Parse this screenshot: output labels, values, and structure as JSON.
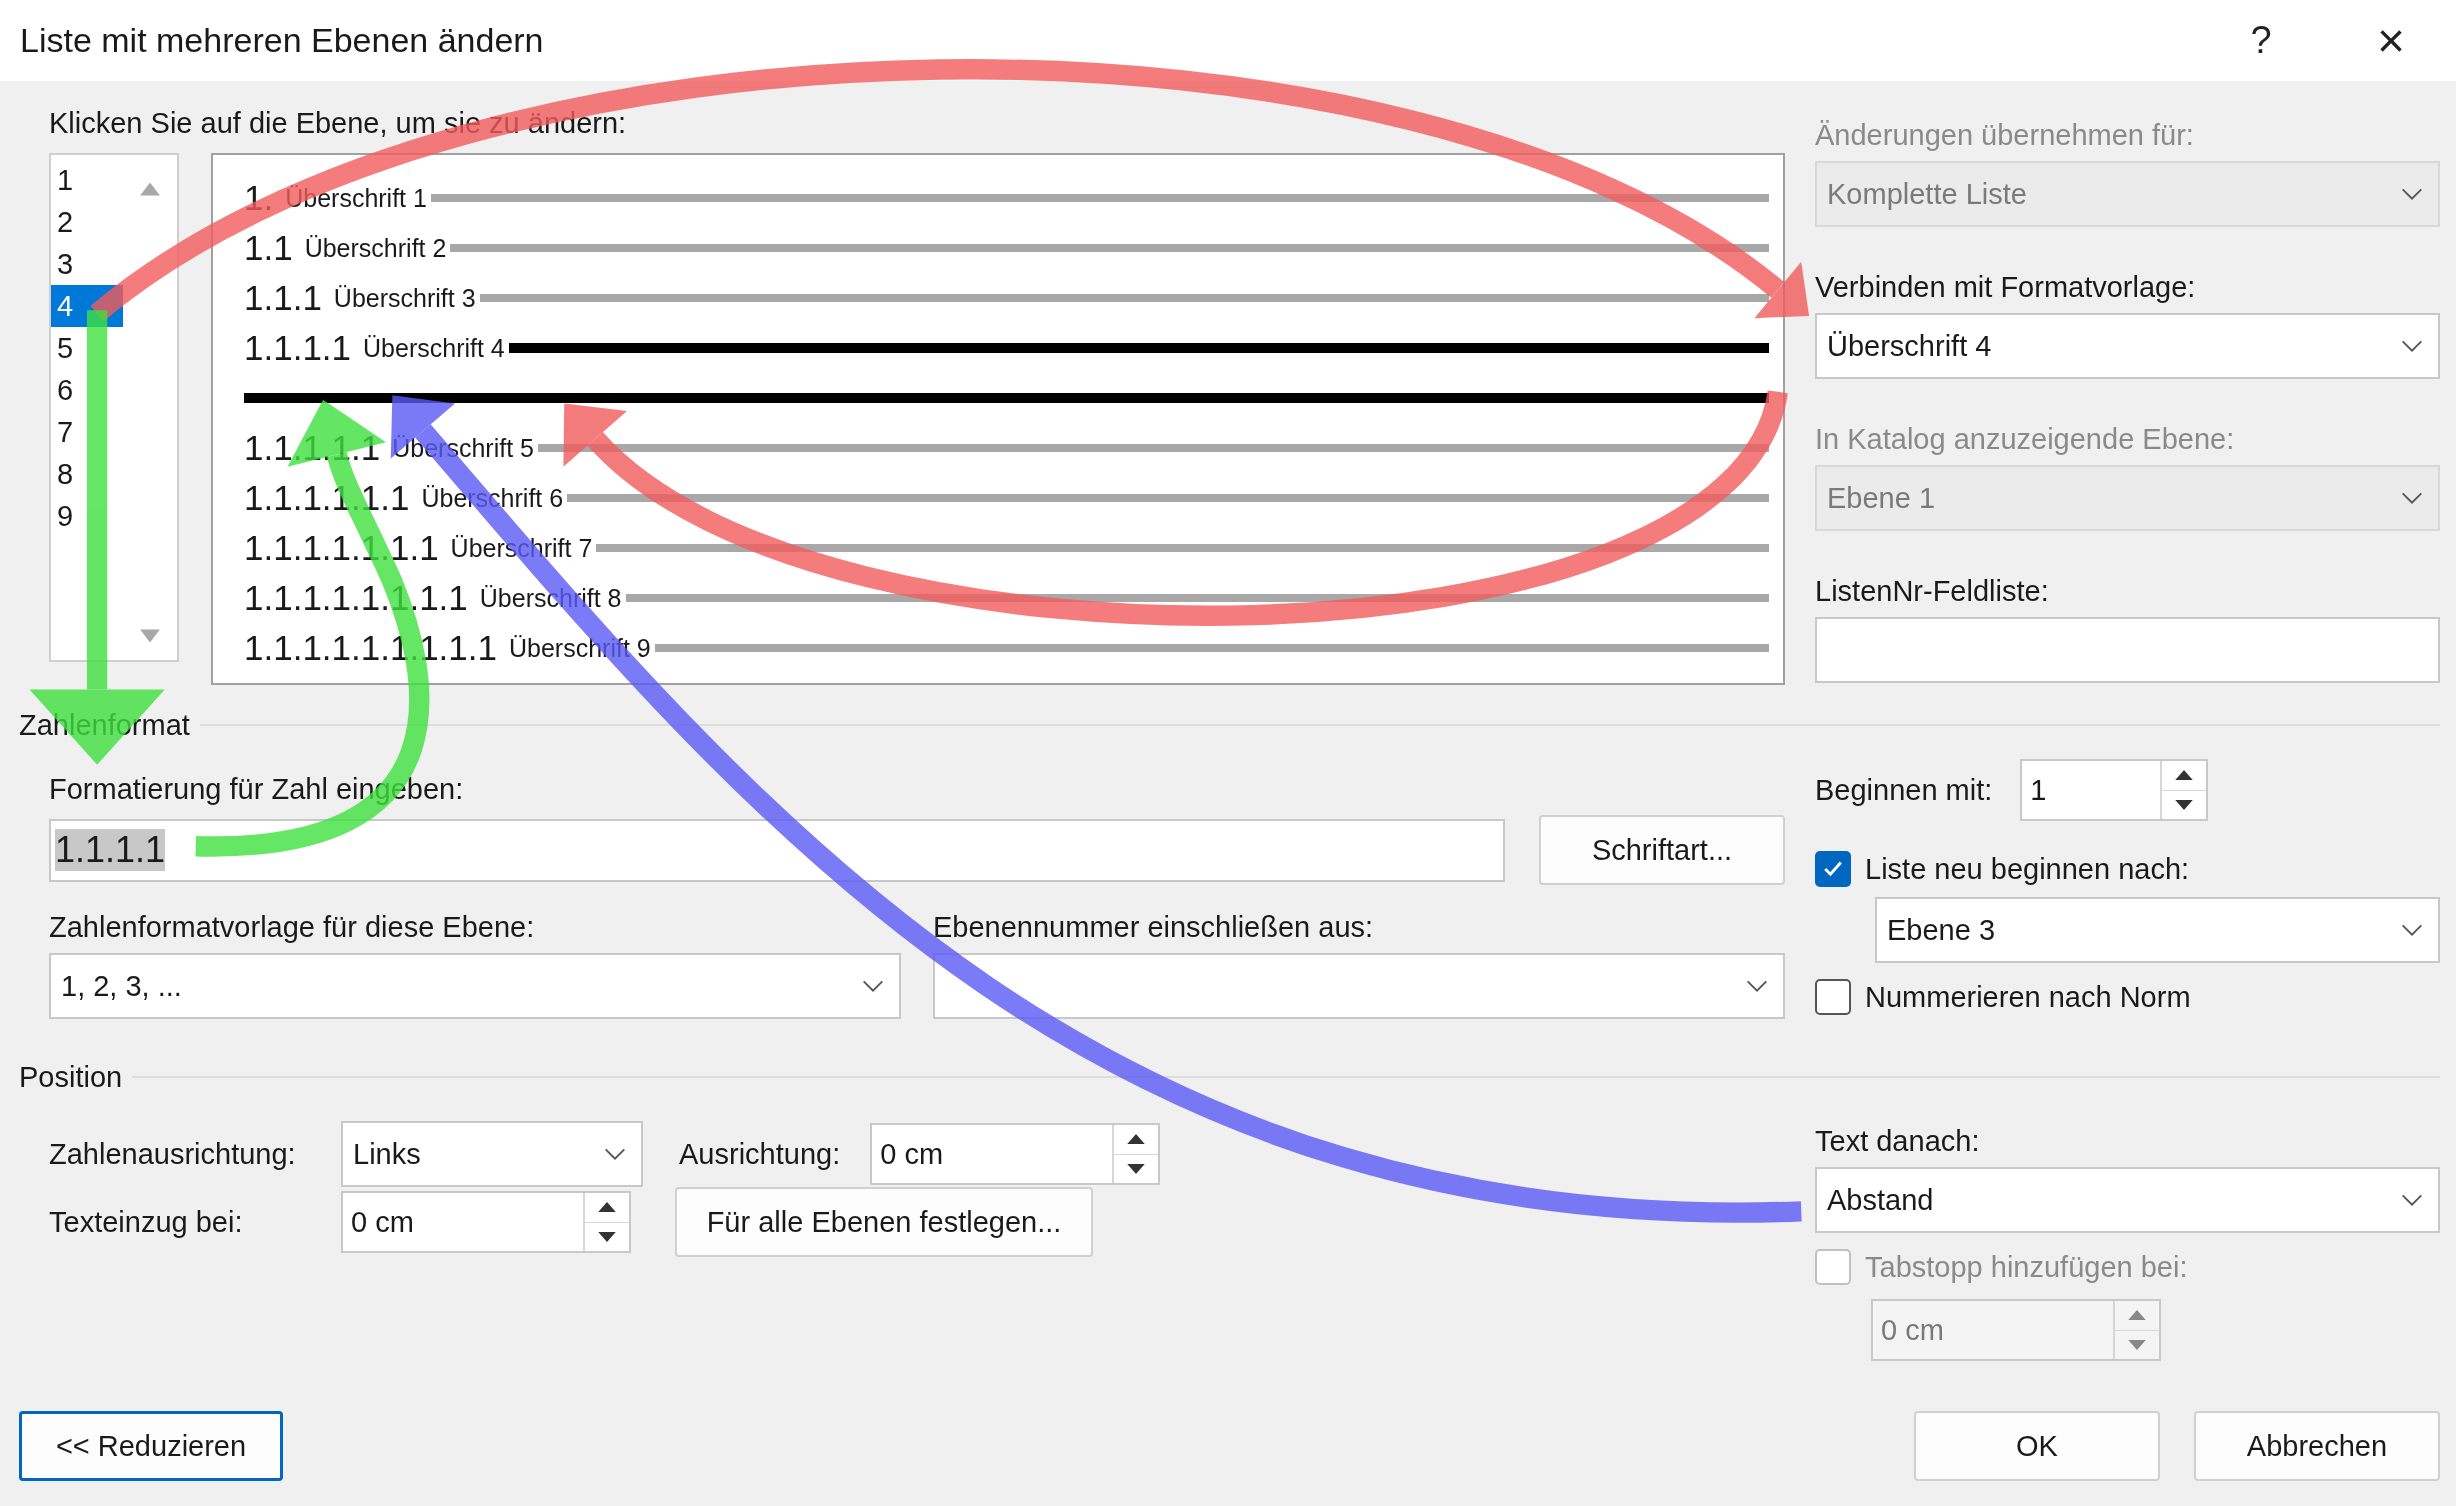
{
  "window": {
    "title": "Liste mit mehreren Ebenen ändern",
    "help": "?",
    "close": "×"
  },
  "level_picker": {
    "label": "Klicken Sie auf die Ebene, um sie zu ändern:",
    "levels": [
      {
        "label": "1",
        "selected": false
      },
      {
        "label": "2",
        "selected": false
      },
      {
        "label": "3",
        "selected": false
      },
      {
        "label": "4",
        "selected": true
      },
      {
        "label": "5",
        "selected": false
      },
      {
        "label": "6",
        "selected": false
      },
      {
        "label": "7",
        "selected": false
      },
      {
        "label": "8",
        "selected": false
      },
      {
        "label": "9",
        "selected": false
      }
    ]
  },
  "preview": [
    {
      "number": "1.",
      "label": "Überschrift 1"
    },
    {
      "number": "1.1",
      "label": "Überschrift 2"
    },
    {
      "number": "1.1.1",
      "label": "Überschrift 3"
    },
    {
      "number": "1.1.1.1",
      "label": "Überschrift 4"
    },
    {
      "number": "1.1.1.1.1",
      "label": "Überschrift 5"
    },
    {
      "number": "1.1.1.1.1.1",
      "label": "Überschrift 6"
    },
    {
      "number": "1.1.1.1.1.1.1",
      "label": "Überschrift 7"
    },
    {
      "number": "1.1.1.1.1.1.1.1",
      "label": "Überschrift 8"
    },
    {
      "number": "1.1.1.1.1.1.1.1.1",
      "label": "Überschrift 9"
    }
  ],
  "link_panel": [
    {
      "label": "Änderungen übernehmen für:",
      "kind": "dropdown",
      "value": "Komplette Liste",
      "disabled": true
    },
    {
      "label": "Verbinden mit Formatvorlage:",
      "kind": "dropdown",
      "value": "Überschrift 4",
      "disabled": false
    },
    {
      "label": "In Katalog anzuzeigende Ebene:",
      "kind": "dropdown",
      "value": "Ebene 1",
      "disabled": true
    },
    {
      "label": "ListenNr-Feldliste:",
      "kind": "text",
      "disabled": false
    }
  ],
  "number_format": {
    "heading": "Zahlenformat",
    "format_label": "Formatierung für Zahl eingeben:",
    "format_value": "1.1.1.1",
    "font_button": "Schriftart...",
    "style_label": "Zahlenformatvorlage für diese Ebene:",
    "style_value": "1, 2, 3, ...",
    "include_label": "Ebenennummer einschließen aus:",
    "start_label": "Beginnen mit:",
    "start_value": "1",
    "restart": {
      "label": "Liste neu beginnen nach:",
      "checked": true,
      "value": "Ebene 3"
    },
    "legal": {
      "label": "Nummerieren nach Norm",
      "checked": false
    }
  },
  "position": {
    "heading": "Position",
    "alignment_label": "Zahlenausrichtung:",
    "alignment_value": "Links",
    "aligned_at_label": "Ausrichtung:",
    "aligned_at_value": "0 cm",
    "indent_label": "Texteinzug bei:",
    "indent_value": "0 cm",
    "set_all_button": "Für alle Ebenen festlegen...",
    "follow_label": "Text danach:",
    "follow_value": "Abstand",
    "tab_stop": {
      "label": "Tabstopp hinzufügen bei:",
      "checked": false,
      "disabled": true,
      "value": "0 cm"
    }
  },
  "buttons": {
    "less": "<< Reduzieren",
    "ok": "OK",
    "cancel": "Abbrechen"
  }
}
